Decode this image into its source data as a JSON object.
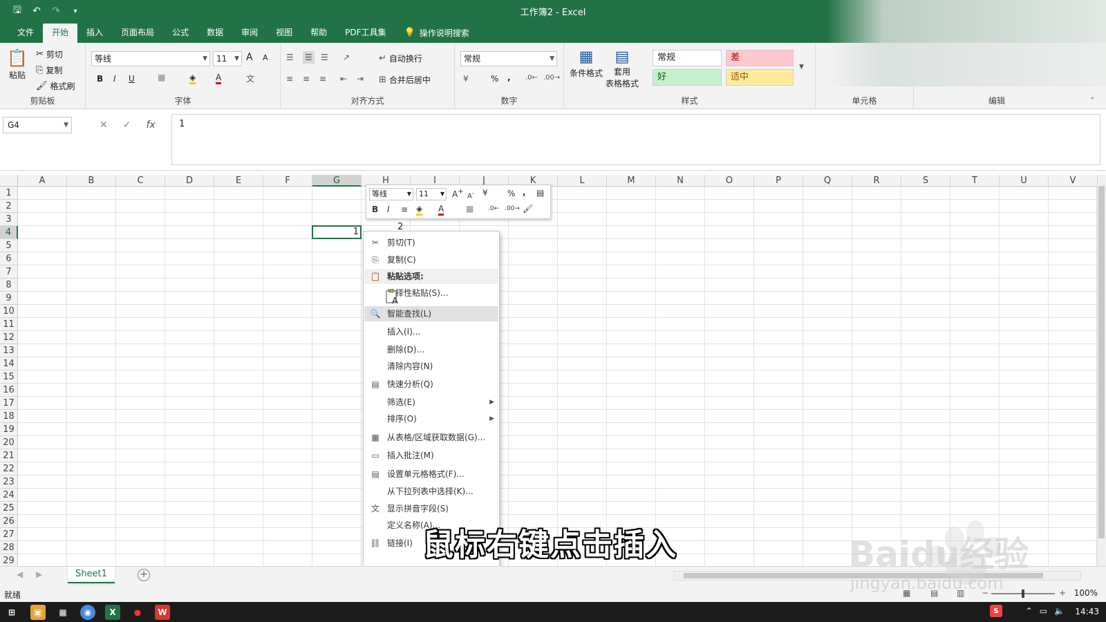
{
  "window": {
    "title": "工作簿2  -  Excel"
  },
  "qat": {
    "save": "🖫",
    "undo": "↶",
    "redo": "↷",
    "customize": "▾"
  },
  "tabs": [
    "文件",
    "开始",
    "插入",
    "页面布局",
    "公式",
    "数据",
    "审阅",
    "视图",
    "帮助",
    "PDF工具集"
  ],
  "tab_search": "操作说明搜索",
  "ribbon": {
    "clipboard": {
      "label": "剪贴板",
      "paste": "粘贴",
      "cut": "剪切",
      "copy": "复制",
      "format_painter": "格式刷"
    },
    "font": {
      "label": "字体",
      "name": "等线",
      "size": "11",
      "bold": "B",
      "italic": "I",
      "underline": "U",
      "grow": "A",
      "shrink": "A"
    },
    "alignment": {
      "label": "对齐方式",
      "wrap": "自动换行",
      "merge": "合并后居中"
    },
    "number": {
      "label": "数字",
      "format": "常规",
      "percent": "%",
      "comma": ","
    },
    "styles": {
      "label": "样式",
      "conditional": "条件格式",
      "table1": "套用",
      "table2": "表格格式",
      "normal": "常规",
      "bad": "差",
      "good": "好",
      "neutral": "适中"
    },
    "cells": {
      "label": "单元格"
    },
    "editing": {
      "label": "编辑"
    }
  },
  "formula_bar": {
    "name_box": "G4",
    "fx": "fx",
    "value": "1"
  },
  "columns": [
    "A",
    "B",
    "C",
    "D",
    "E",
    "F",
    "G",
    "H",
    "I",
    "J",
    "K",
    "L",
    "M",
    "N",
    "O",
    "P",
    "Q",
    "R",
    "S",
    "T",
    "U",
    "V"
  ],
  "rows": [
    "1",
    "2",
    "3",
    "4",
    "5",
    "6",
    "7",
    "8",
    "9",
    "10",
    "11",
    "12",
    "13",
    "14",
    "15",
    "16",
    "17",
    "18",
    "19",
    "20",
    "21",
    "22",
    "23",
    "24",
    "25",
    "26",
    "27",
    "28",
    "29"
  ],
  "active_cell": {
    "ref": "G4",
    "value": "1",
    "neighbor_value": "2"
  },
  "mini_toolbar": {
    "font": "等线",
    "size": "11",
    "bold": "B",
    "italic": "I",
    "percent": "%",
    "comma": ","
  },
  "context_menu": [
    {
      "label": "剪切(T)",
      "icon": "✂",
      "name": "cut"
    },
    {
      "label": "复制(C)",
      "icon": "⎘",
      "name": "copy"
    },
    {
      "label": "粘贴选项:",
      "icon": "📋",
      "name": "paste-options",
      "section": true
    },
    {
      "label": "选择性粘贴(S)...",
      "icon": "",
      "name": "paste-special"
    },
    {
      "label": "智能查找(L)",
      "icon": "🔍",
      "name": "smart-lookup",
      "highlight": true
    },
    {
      "label": "插入(I)...",
      "icon": "",
      "name": "insert"
    },
    {
      "label": "删除(D)...",
      "icon": "",
      "name": "delete"
    },
    {
      "label": "清除内容(N)",
      "icon": "",
      "name": "clear-contents"
    },
    {
      "label": "快速分析(Q)",
      "icon": "▤",
      "name": "quick-analysis"
    },
    {
      "label": "筛选(E)",
      "icon": "",
      "name": "filter",
      "submenu": true
    },
    {
      "label": "排序(O)",
      "icon": "",
      "name": "sort",
      "submenu": true
    },
    {
      "label": "从表格/区域获取数据(G)...",
      "icon": "▦",
      "name": "get-data"
    },
    {
      "label": "插入批注(M)",
      "icon": "▭",
      "name": "insert-comment"
    },
    {
      "label": "设置单元格格式(F)...",
      "icon": "▤",
      "name": "format-cells"
    },
    {
      "label": "从下拉列表中选择(K)...",
      "icon": "",
      "name": "pick-from-list"
    },
    {
      "label": "显示拼音字段(S)",
      "icon": "文",
      "name": "show-phonetic"
    },
    {
      "label": "定义名称(A)...",
      "icon": "",
      "name": "define-name"
    },
    {
      "label": "链接(I)",
      "icon": "⛓",
      "name": "link"
    }
  ],
  "sheet_tab": "Sheet1",
  "status": {
    "ready": "就绪",
    "zoom": "100%"
  },
  "taskbar": {
    "time": "14:43"
  },
  "subtitle": "鼠标右键点击插入",
  "watermark": {
    "brand": "Baidu经验",
    "url": "jingyan.baidu.com"
  }
}
